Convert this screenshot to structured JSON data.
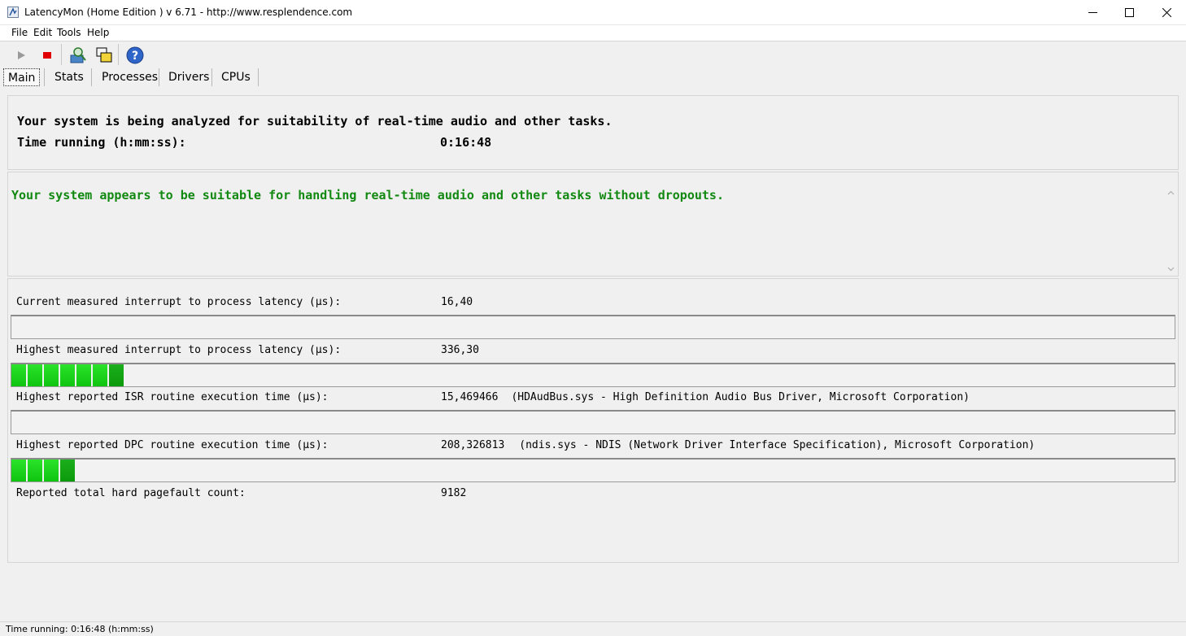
{
  "window": {
    "title": "LatencyMon  (Home Edition )  v 6.71 - http://www.resplendence.com"
  },
  "menu": [
    {
      "label": "File"
    },
    {
      "label": "Edit"
    },
    {
      "label": "Tools"
    },
    {
      "label": "Help"
    }
  ],
  "toolbar": {
    "icons": [
      "play-icon",
      "stop-icon",
      "analyze-icon",
      "windows-icon",
      "help-icon"
    ]
  },
  "tabs": [
    {
      "label": "Main",
      "active": true
    },
    {
      "label": "Stats"
    },
    {
      "label": "Processes"
    },
    {
      "label": "Drivers"
    },
    {
      "label": "CPUs"
    }
  ],
  "summary": {
    "analyzing_text": "Your system is being analyzed for suitability of real-time audio and other tasks.",
    "time_label": "Time running (h:mm:ss):",
    "time_value": "0:16:48"
  },
  "verdict": {
    "text": "Your system appears to be suitable for handling real-time audio and other tasks without dropouts.",
    "color": "#118911"
  },
  "metrics": [
    {
      "label": "Current measured interrupt to process latency (µs):",
      "value": "16,40",
      "detail": "",
      "bar_segments": 0
    },
    {
      "label": "Highest measured interrupt to process latency (µs):",
      "value": "336,30",
      "detail": "",
      "bar_segments": 7
    },
    {
      "label": "Highest reported ISR routine execution time (µs):",
      "value": "15,469466",
      "detail": "(HDAudBus.sys - High Definition Audio Bus Driver, Microsoft Corporation)",
      "bar_segments": 0
    },
    {
      "label": "Highest reported DPC routine execution time (µs):",
      "value": "208,326813",
      "detail": "(ndis.sys - NDIS (Network Driver Interface Specification), Microsoft Corporation)",
      "bar_segments": 4
    }
  ],
  "pagefault": {
    "label": "Reported total hard pagefault count:",
    "value": "9182"
  },
  "status": {
    "text": "Time running: 0:16:48  (h:mm:ss)"
  },
  "colors": {
    "bar_green": "#10c410",
    "bar_dark_green": "#0b9a0b"
  }
}
